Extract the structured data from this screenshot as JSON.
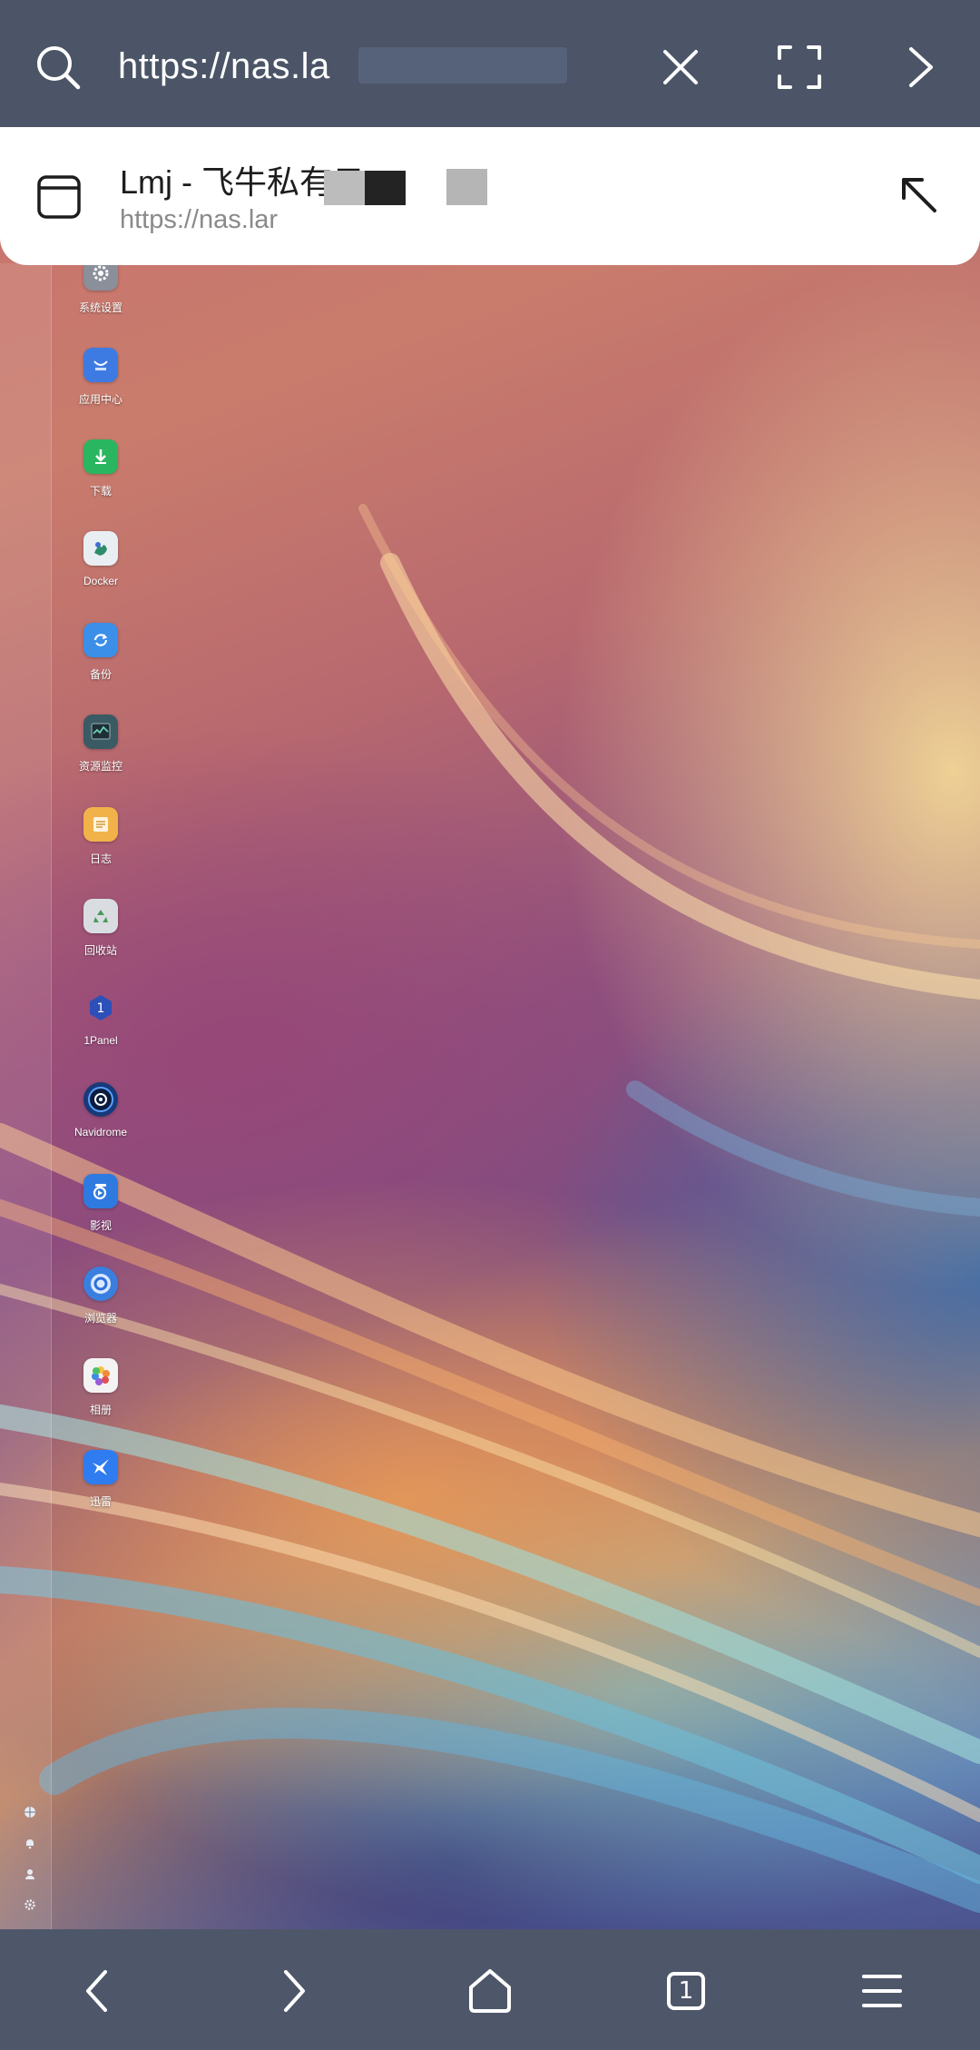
{
  "address_bar": {
    "url_text": "https://nas.la"
  },
  "suggestion": {
    "title": "Lmj - 飞牛私有云",
    "url": "https://nas.lar"
  },
  "dock": {
    "apps": [
      {
        "label": "系统设置",
        "icon": "gear-icon",
        "color": "#8a8f99"
      },
      {
        "label": "应用中心",
        "icon": "app-store-icon",
        "color": "#3d7be3"
      },
      {
        "label": "下载",
        "icon": "download-icon",
        "color": "#2ab660"
      },
      {
        "label": "Docker",
        "icon": "docker-icon",
        "color": "#e9eef3"
      },
      {
        "label": "备份",
        "icon": "backup-icon",
        "color": "#3c8fe8"
      },
      {
        "label": "资源监控",
        "icon": "monitor-icon",
        "color": "#3a5a64"
      },
      {
        "label": "日志",
        "icon": "log-icon",
        "color": "#f1b24a"
      },
      {
        "label": "回收站",
        "icon": "recycle-bin-icon",
        "color": "#d9dde2"
      },
      {
        "label": "1Panel",
        "icon": "1panel-icon",
        "color": "#2d4fb8"
      },
      {
        "label": "Navidrome",
        "icon": "navidrome-icon",
        "color": "#163a7a"
      },
      {
        "label": "影视",
        "icon": "video-icon",
        "color": "#2f7ae0"
      },
      {
        "label": "浏览器",
        "icon": "browser-icon",
        "color": "#3a7fe0"
      },
      {
        "label": "相册",
        "icon": "photos-icon",
        "color": "#f3f3f3"
      },
      {
        "label": "迅雷",
        "icon": "thunder-icon",
        "color": "#2f7cf0"
      }
    ]
  },
  "bottom_nav": {
    "tab_count": "1"
  },
  "colors": {
    "top_bar": "#4b5567",
    "bottom_bar": "#4e5769",
    "card": "#ffffff"
  }
}
